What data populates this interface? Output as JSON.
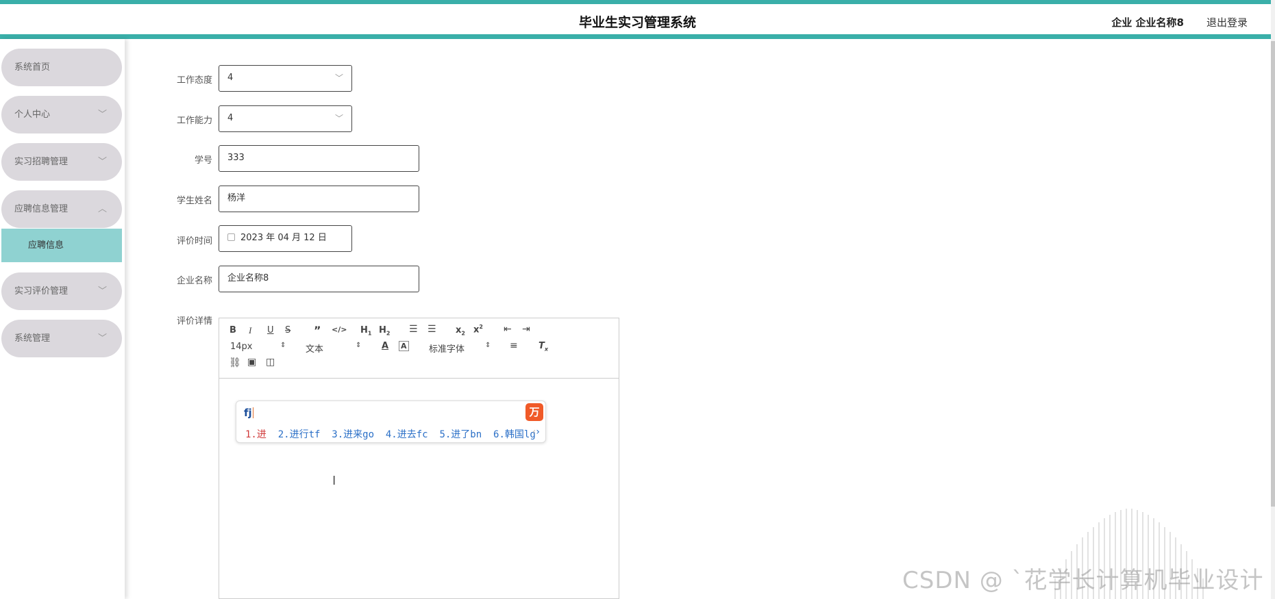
{
  "header": {
    "title": "毕业生实习管理系统",
    "user": "企业 企业名称8",
    "logout": "退出登录"
  },
  "sidebar": {
    "items": [
      {
        "label": "系统首页"
      },
      {
        "label": "个人中心",
        "chevron": "﹀"
      },
      {
        "label": "实习招聘管理",
        "chevron": "﹀"
      },
      {
        "label": "应聘信息管理",
        "chevron": "︿"
      },
      {
        "label": "实习评价管理",
        "chevron": "﹀"
      },
      {
        "label": "系统管理",
        "chevron": "﹀"
      }
    ],
    "sub_item": "应聘信息"
  },
  "form": {
    "attitude": {
      "label": "工作态度",
      "value": "4"
    },
    "ability": {
      "label": "工作能力",
      "value": "4"
    },
    "student_no": {
      "label": "学号",
      "value": "333"
    },
    "student_name": {
      "label": "学生姓名",
      "value": "杨洋"
    },
    "eval_time": {
      "label": "评价时间",
      "value": "2023 年 04 月 12 日"
    },
    "company": {
      "label": "企业名称",
      "value": "企业名称8"
    },
    "detail": {
      "label": "评价详情"
    }
  },
  "editor": {
    "font_size": "14px",
    "paragraph": "文本",
    "font_family": "标准字体"
  },
  "ime": {
    "input": "fj",
    "candidates": [
      "1.进",
      "2.进行tf",
      "3.进来go",
      "4.进去fc",
      "5.进了bn",
      "6.韩国lg"
    ]
  },
  "watermark": "CSDN @ ˋ花学长计算机毕业设计"
}
